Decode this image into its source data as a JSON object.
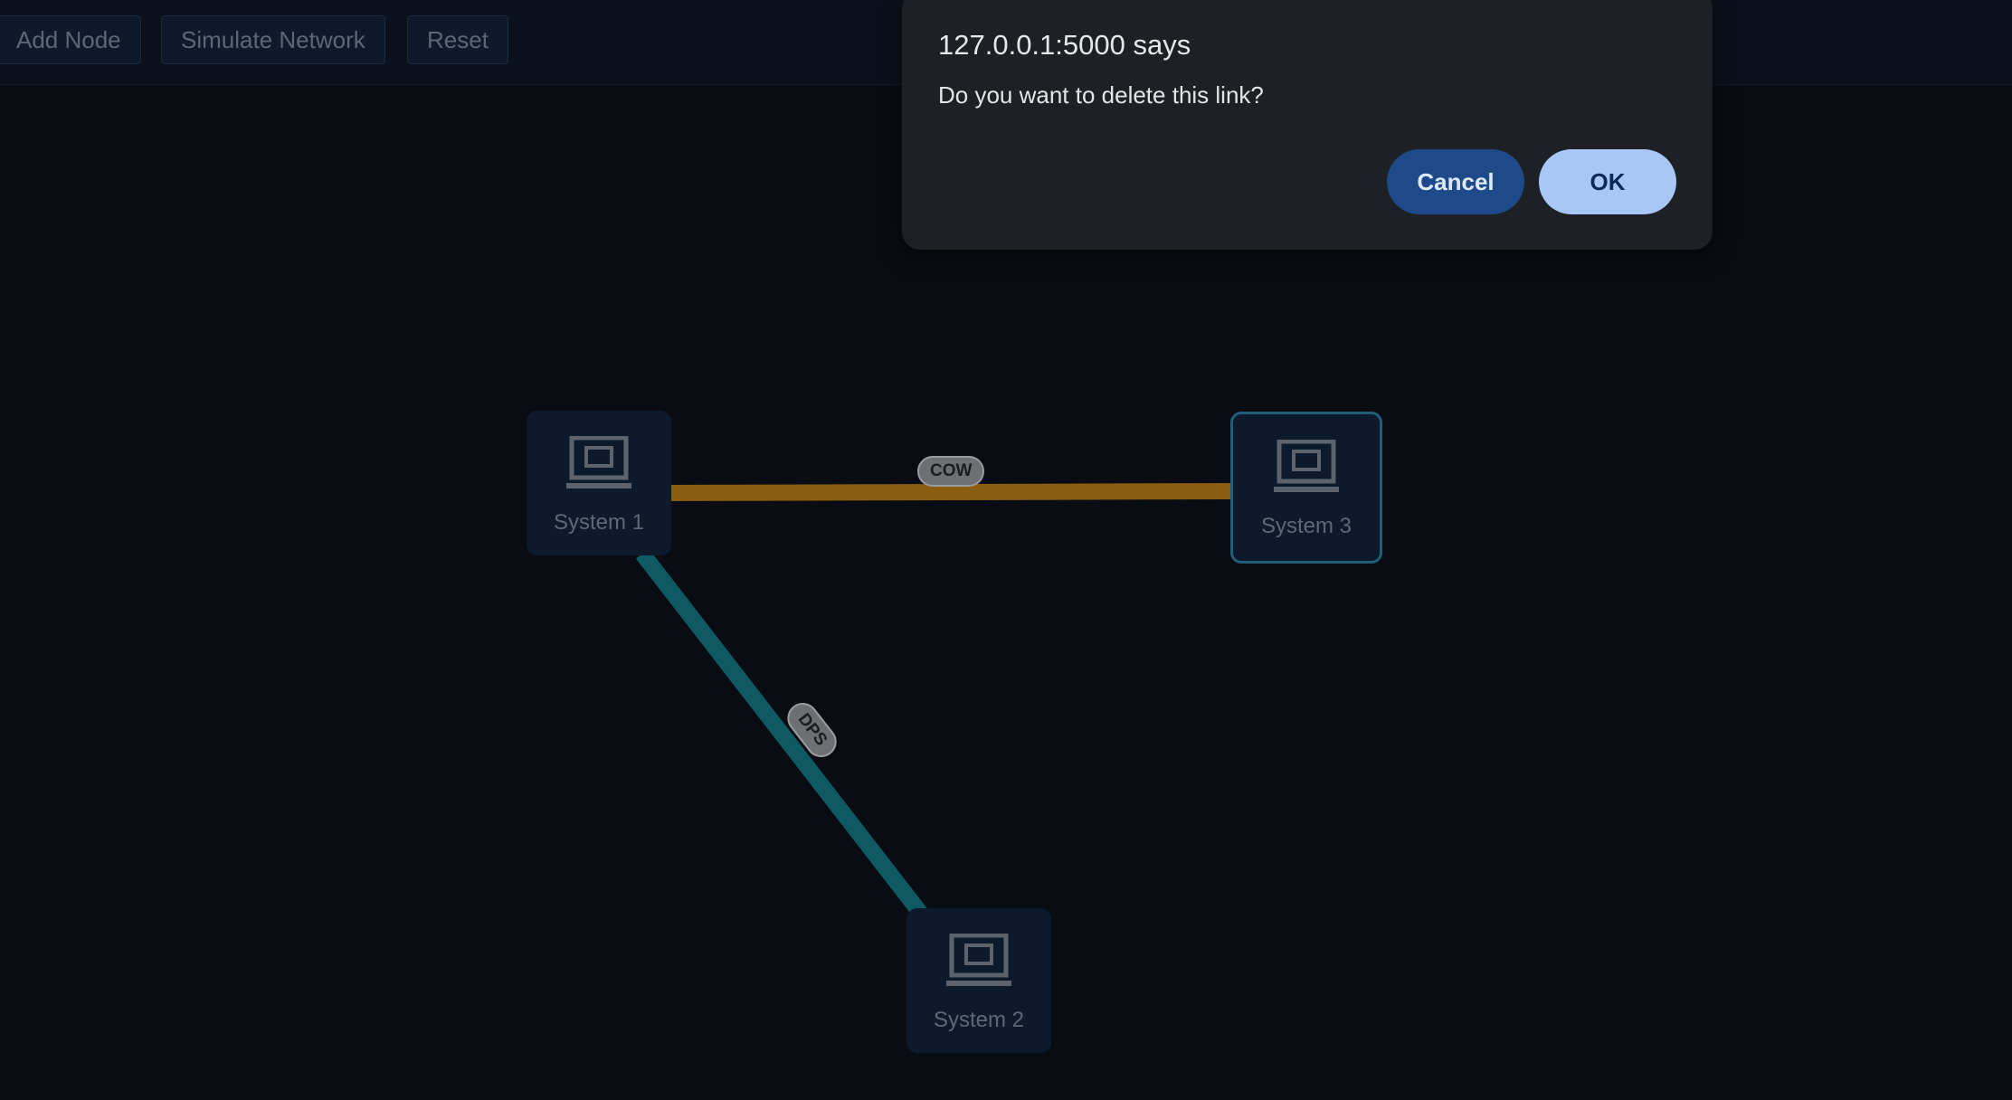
{
  "toolbar": {
    "add_node": "Add Node",
    "simulate_network": "Simulate Network",
    "reset": "Reset"
  },
  "network": {
    "nodes": [
      {
        "label": "System 1",
        "icon": "laptop-icon",
        "selected": false
      },
      {
        "label": "System 2",
        "icon": "laptop-icon",
        "selected": false
      },
      {
        "label": "System 3",
        "icon": "laptop-icon",
        "selected": true
      }
    ],
    "links": [
      {
        "from": "System 1",
        "to": "System 3",
        "label": "COW",
        "color": "#8a5e12"
      },
      {
        "from": "System 1",
        "to": "System 2",
        "label": "DPS",
        "color": "#0f5963"
      }
    ]
  },
  "dialog": {
    "origin": "127.0.0.1:5000 says",
    "message": "Do you want to delete this link?",
    "cancel_label": "Cancel",
    "ok_label": "OK"
  },
  "colors": {
    "background": "#090c13",
    "node_bg": "#0c1a2c",
    "selected_border": "#1f5f7a",
    "dialog_bg": "#1d2024",
    "ok_button": "#a9c7f6",
    "cancel_button": "#1e4a8a"
  }
}
